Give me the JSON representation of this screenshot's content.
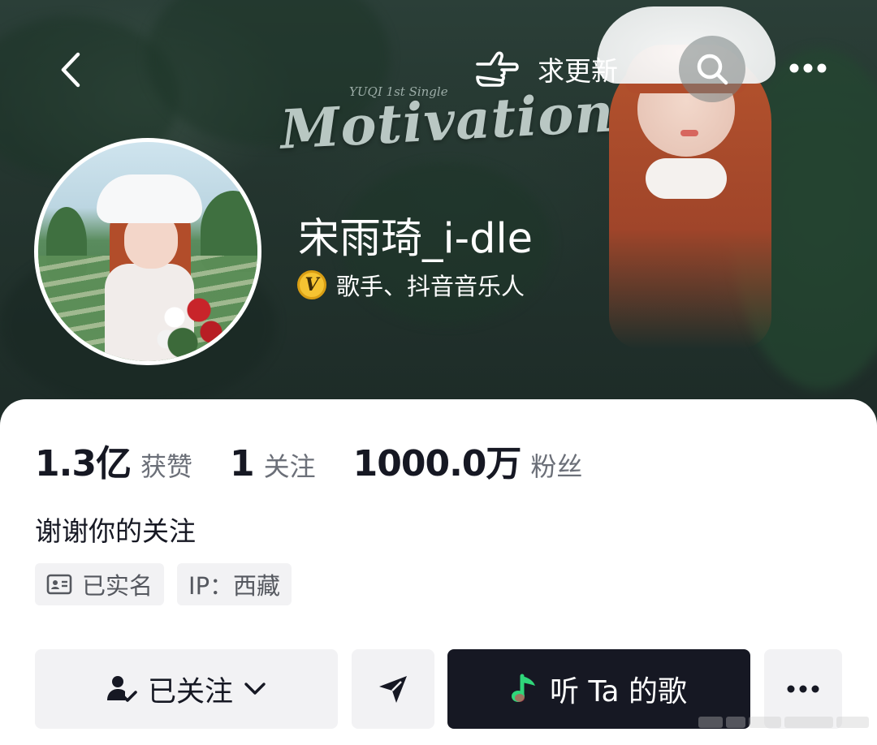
{
  "header": {
    "back_icon": "chevron-left-icon",
    "request_update": {
      "icon": "pointing-hand-icon",
      "label": "求更新"
    },
    "search_icon": "search-icon",
    "more_icon": "more-horizontal-icon"
  },
  "banner": {
    "subtitle": "YUQI 1st Single",
    "title": "Motivation"
  },
  "profile": {
    "username": "宋雨琦_i-dle",
    "verified_badge": "V",
    "verification": "歌手、抖音音乐人"
  },
  "stats": [
    {
      "value": "1.3亿",
      "label": "获赞"
    },
    {
      "value": "1",
      "label": "关注"
    },
    {
      "value": "1000.0万",
      "label": "粉丝"
    }
  ],
  "bio": "谢谢你的关注",
  "tags": [
    {
      "icon": "id-card-icon",
      "label": "已实名"
    },
    {
      "icon": "",
      "label": "IP：西藏"
    }
  ],
  "actions": {
    "follow": {
      "icon": "user-check-icon",
      "label": "已关注"
    },
    "share": {
      "icon": "send-icon"
    },
    "listen": {
      "icon": "music-note-icon",
      "label": "听 Ta 的歌"
    },
    "more": {
      "icon": "more-horizontal-icon"
    }
  },
  "colors": {
    "primary_text": "#161823",
    "secondary_text": "#6b6f78",
    "button_bg": "#f2f2f4",
    "listen_bg": "#161823",
    "verify_badge": "#f5c332",
    "music_icon_green": "#2fd67a"
  }
}
